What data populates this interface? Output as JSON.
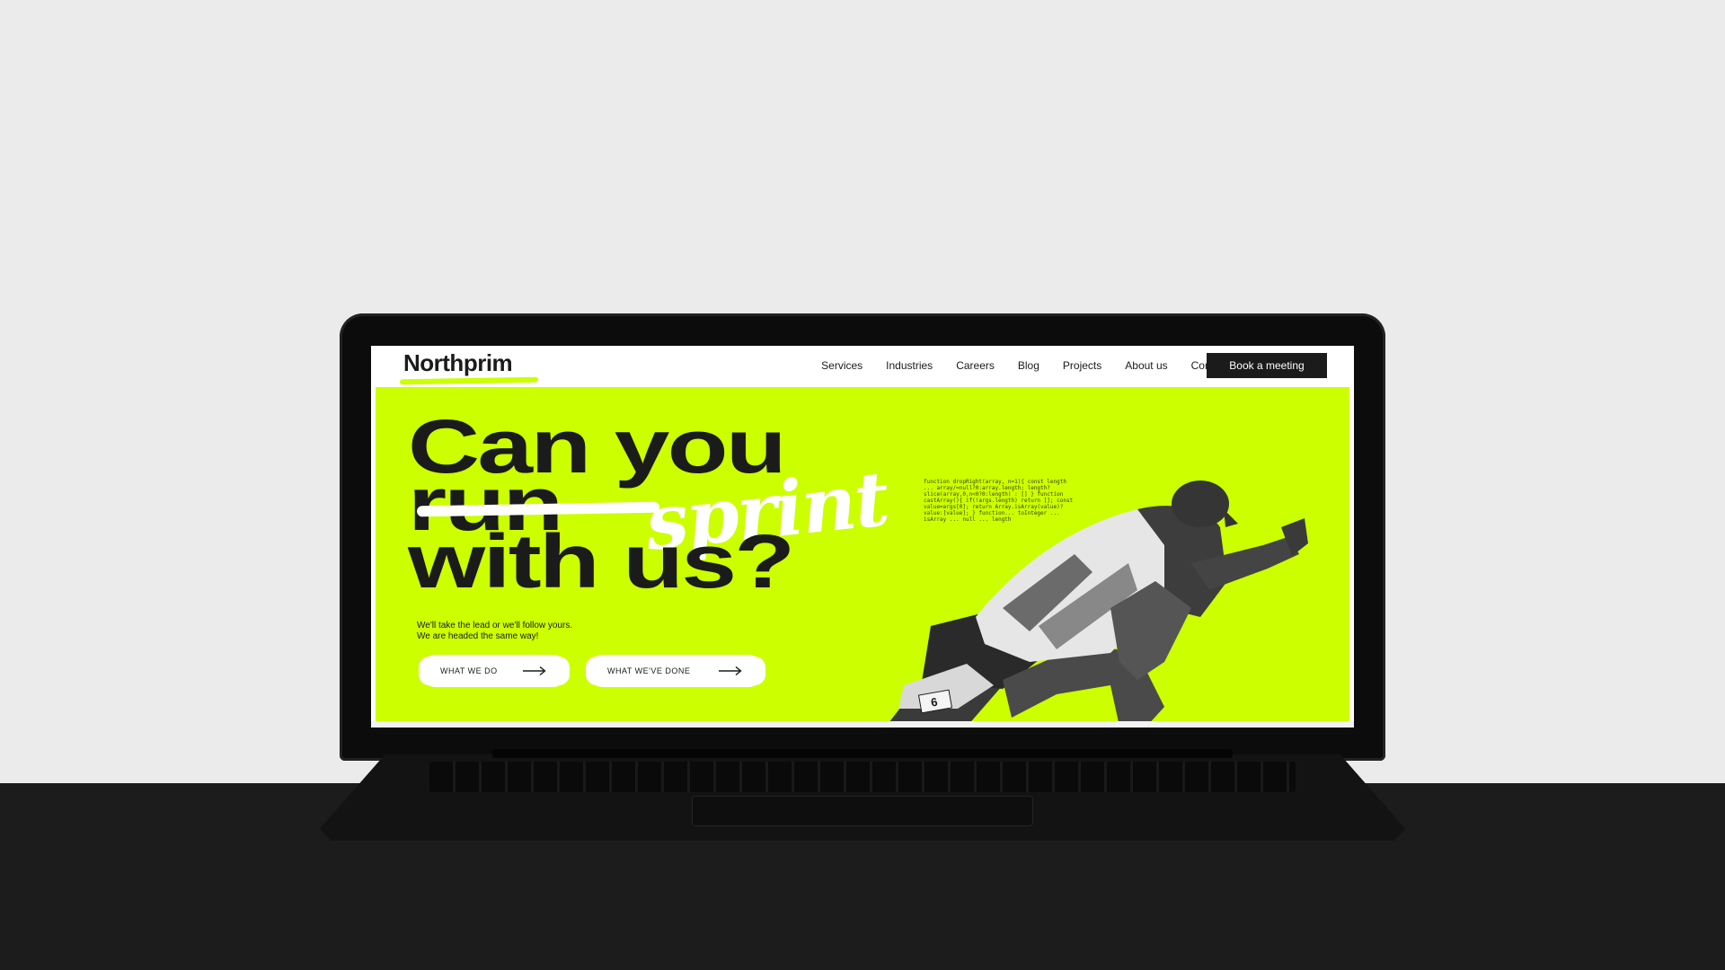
{
  "nav": {
    "logo": "Northprim",
    "links": [
      "Services",
      "Industries",
      "Careers",
      "Blog",
      "Projects",
      "About us",
      "Contact"
    ],
    "cta": "Book a meeting"
  },
  "hero": {
    "line1": "Can you",
    "line2_struck": "run",
    "line2_script": "sprint",
    "line3": "with us?",
    "subtext_line1": "We'll take the lead or we'll follow yours.",
    "subtext_line2": "We are headed the same way!",
    "button1": "WHAT WE DO",
    "button2": "WHAT WE'VE DONE",
    "bib_number": "6",
    "code_text": "function dropRight(array, n=1){ const length ... array/=null?0:array.length; length?slice(array,0,n<0?0:length) : [] } function castArray(){ if(!args.length) return []; const value=args[0]; return Array.isArray(value)?value:[value]; } function... toInteger ... isArray ... null ... length"
  },
  "colors": {
    "accent": "#ccff00",
    "dark": "#1b1b1b",
    "white": "#ffffff",
    "background": "#ebebeb",
    "floor": "#1c1c1c"
  }
}
